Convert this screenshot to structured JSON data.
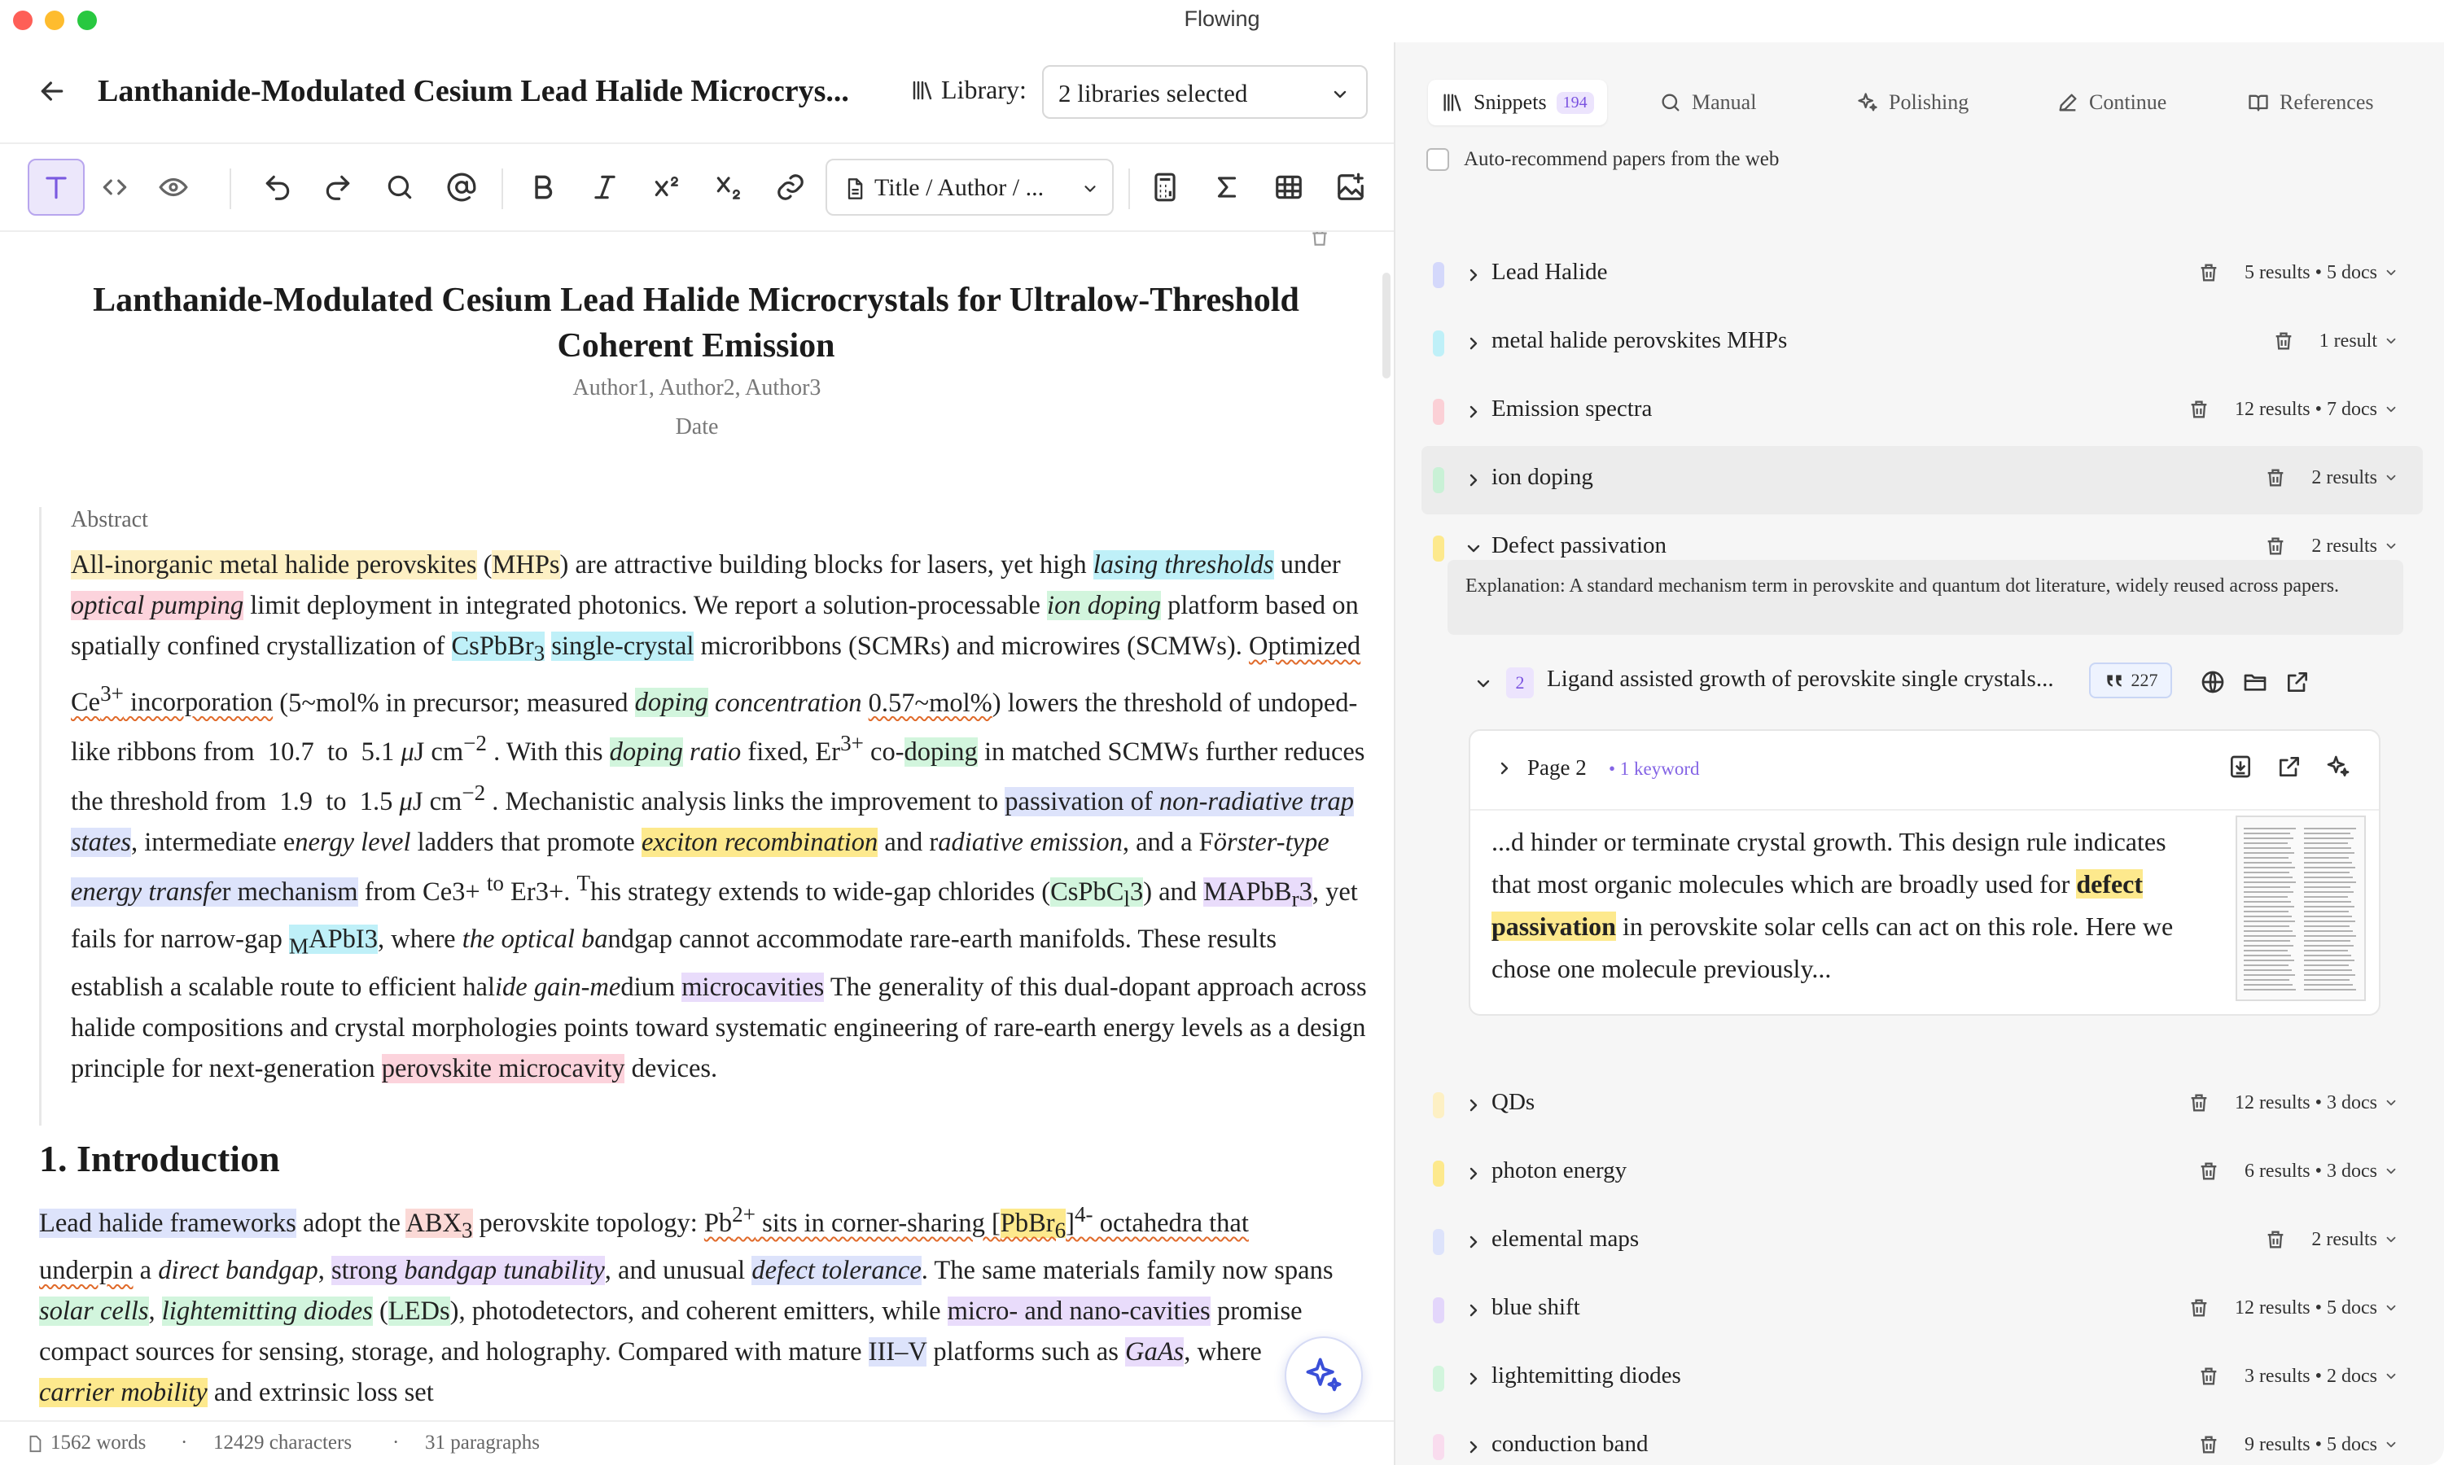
{
  "app": {
    "title": "Flowing"
  },
  "header": {
    "doc_title": "Lanthanide-Modulated Cesium Lead Halide Microcrys...",
    "library_label": "Library:",
    "library_value": "2 libraries selected"
  },
  "toolbar": {
    "format_select": "Title / Author / ..."
  },
  "paper": {
    "title": "Lanthanide-Modulated Cesium Lead Halide Microcrystals for Ultralow-Threshold Coherent Emission",
    "authors": "Author1, Author2, Author3",
    "date": "Date",
    "abstract_label": "Abstract",
    "section1_title": "1. Introduction"
  },
  "status": {
    "words": "1562 words",
    "characters": "12429 characters",
    "paragraphs": "31 paragraphs"
  },
  "right": {
    "tabs": [
      {
        "label": "Snippets",
        "badge": "194"
      },
      {
        "label": "Manual"
      },
      {
        "label": "Polishing"
      },
      {
        "label": "Continue"
      },
      {
        "label": "References"
      }
    ],
    "auto_recommend": "Auto-recommend papers from the web",
    "keywords": [
      {
        "name": "Lead Halide",
        "meta": "5 results • 5 docs",
        "color": "#d4d8fb"
      },
      {
        "name": "metal halide perovskites MHPs",
        "meta": "1 result",
        "color": "#bff0f8"
      },
      {
        "name": "Emission spectra",
        "meta": "12 results • 7 docs",
        "color": "#fbd0d6"
      },
      {
        "name": "ion doping",
        "meta": "2 results",
        "color": "#c9f1d6"
      },
      {
        "name": "Defect passivation",
        "meta": "2 results",
        "color": "#fde98d"
      },
      {
        "name": "QDs",
        "meta": "12 results • 3 docs",
        "color": "#fdf0c4"
      },
      {
        "name": "photon energy",
        "meta": "6 results • 3 docs",
        "color": "#fde98d"
      },
      {
        "name": "elemental maps",
        "meta": "2 results",
        "color": "#dde3fb"
      },
      {
        "name": "blue shift",
        "meta": "12 results • 5 docs",
        "color": "#e3d6fb"
      },
      {
        "name": "lightemitting diodes",
        "meta": "3 results • 2 docs",
        "color": "#d2f5dd"
      },
      {
        "name": "conduction band",
        "meta": "9 results • 5 docs",
        "color": "#f9dcee"
      }
    ],
    "explanation": "Explanation: A standard mechanism term in perovskite and quantum dot literature, widely reused across papers.",
    "paper_item": {
      "index": "2",
      "title": "Ligand assisted growth of perovskite single crystals...",
      "citations": "227"
    },
    "page_card": {
      "page": "Page 2",
      "keyword_count": "• 1 keyword",
      "snippet_before": "...d hinder or terminate crystal growth. This design rule indicates that most organic molecules which are broadly used for ",
      "snippet_highlight": "defect passivation",
      "snippet_after": " in perovskite solar cells can act on this role. Here we chose one molecule previously..."
    }
  }
}
